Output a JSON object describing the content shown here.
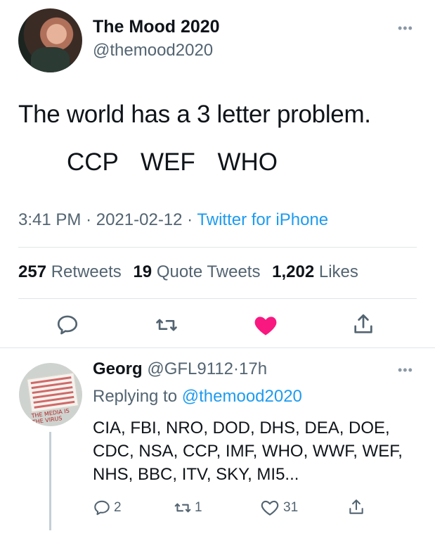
{
  "tweet": {
    "display_name": "The Mood 2020",
    "handle": "@themood2020",
    "text_line1": "The world has a 3 letter problem.",
    "text_line2": "CCP WEF WHO",
    "time": "3:41 PM",
    "date": "2021-02-12",
    "source": "Twitter for iPhone",
    "separator": "·",
    "stats": {
      "retweets_count": "257",
      "retweets_label": "Retweets",
      "quotes_count": "19",
      "quotes_label": "Quote Tweets",
      "likes_count": "1,202",
      "likes_label": "Likes"
    },
    "more_label": "•••"
  },
  "actions": {
    "icons": [
      "reply-icon",
      "retweet-icon",
      "heart-icon",
      "share-icon"
    ],
    "like_color": "#f91880"
  },
  "reply": {
    "display_name": "Georg",
    "handle": "@GFL9112",
    "time": "17h",
    "separator": "·",
    "replying_prefix": "Replying to",
    "replying_handle": "@themood2020",
    "text": "CIA, FBI, NRO, DOD, DHS, DEA, DOE, CDC, NSA, CCP, IMF, WHO, WWF, WEF, NHS, BBC, ITV, SKY, MI5...",
    "avatar_sign_text": "THE MEDIA IS THE VIRUS",
    "counts": {
      "replies": "2",
      "retweets": "1",
      "likes": "31"
    },
    "more_label": "•••"
  },
  "colors": {
    "link_blue": "#1d9bf0",
    "secondary_text": "#536471",
    "primary_text": "#0f1419"
  }
}
